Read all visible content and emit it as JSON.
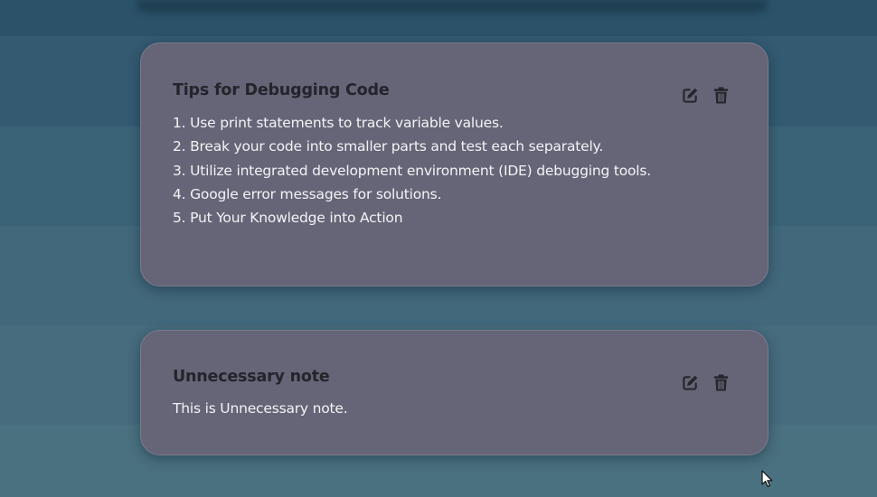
{
  "notes": [
    {
      "title": "Tips for Debugging Code",
      "lines": [
        "1. Use print statements to track variable values.",
        "2. Break your code into smaller parts and test each separately.",
        "3. Utilize integrated development environment (IDE) debugging tools.",
        "4. Google error messages for solutions.",
        "5. Put Your Knowledge into Action"
      ],
      "actions": {
        "edit_icon": "edit-icon",
        "delete_icon": "trash-icon"
      }
    },
    {
      "title": "Unnecessary note",
      "lines": [
        "This is Unnecessary note."
      ],
      "actions": {
        "edit_icon": "edit-icon",
        "delete_icon": "trash-icon"
      }
    }
  ],
  "colors": {
    "card_background": "#666577",
    "title_text": "#24242c",
    "body_text": "#f3f3f6",
    "icon": "#25252c"
  }
}
